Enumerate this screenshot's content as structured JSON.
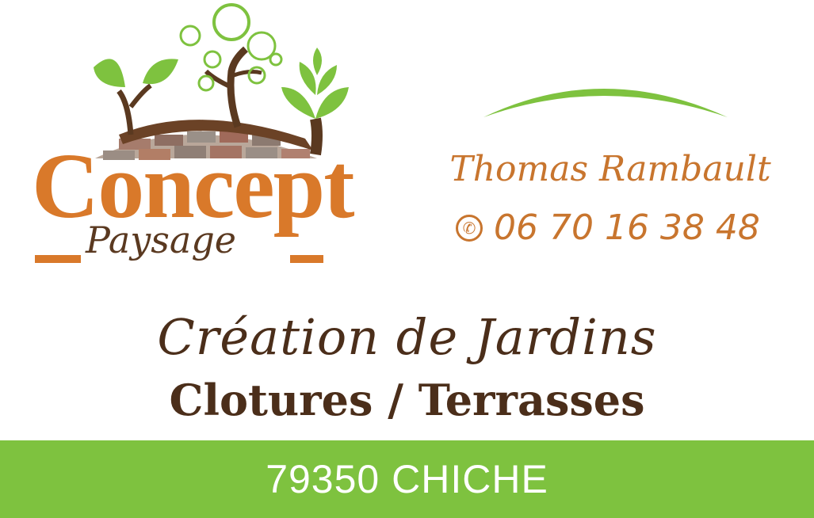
{
  "brand": {
    "name": "Concept",
    "subtitle": "Paysage"
  },
  "contact": {
    "name": "Thomas Rambault",
    "phone": "06 70 16 38 48",
    "phone_icon": "phone-icon"
  },
  "taglines": {
    "line1": "Création de Jardins",
    "line2": "Clotures / Terrasses"
  },
  "footer": {
    "location": "79350 CHICHE"
  },
  "colors": {
    "orange": "#d9792a",
    "brown": "#4b2e1a",
    "green": "#7ec23f",
    "white": "#ffffff"
  }
}
